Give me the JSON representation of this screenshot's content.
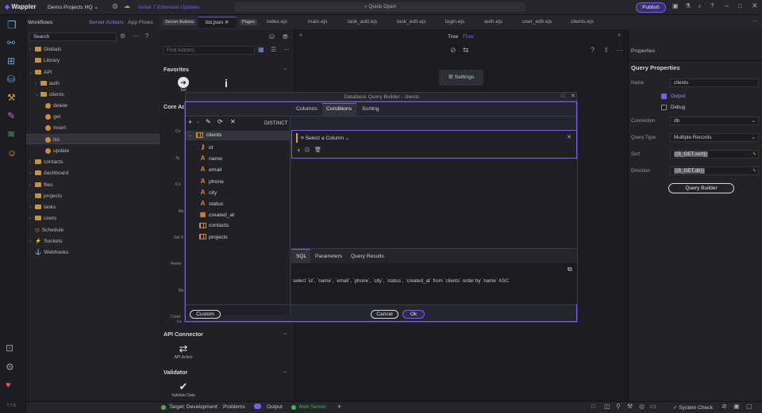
{
  "app": {
    "name": "Wappler",
    "project": "Demo Projects HQ",
    "update_notice": "Install 7 Extension Updates",
    "quick_open": "Quick Open",
    "publish": "Publish"
  },
  "workflows": {
    "title": "Workflows",
    "tab_server": "Server Actions",
    "tab_app": "App Flows",
    "search_placeholder": "Search",
    "tree": [
      {
        "label": "Globals"
      },
      {
        "label": "Library"
      },
      {
        "label": "API"
      },
      {
        "label": "auth"
      },
      {
        "label": "clients"
      },
      {
        "label": "delete"
      },
      {
        "label": "get"
      },
      {
        "label": "insert"
      },
      {
        "label": "list"
      },
      {
        "label": "update"
      },
      {
        "label": "contacts"
      },
      {
        "label": "dashboard"
      },
      {
        "label": "files"
      },
      {
        "label": "projects"
      },
      {
        "label": "tasks"
      },
      {
        "label": "users"
      },
      {
        "label": "Schedule"
      },
      {
        "label": "Sockets"
      },
      {
        "label": "Webhooks"
      }
    ]
  },
  "editor_tabs": {
    "server_actions_tag": "Server Actions",
    "pages_tag": "Pages",
    "items": [
      "list.json",
      "index.ejs",
      "main.ejs",
      "task_add.ejs",
      "task_edit.ejs",
      "login.ejs",
      "auth.ejs",
      "user_edit.ejs",
      "clients.ejs"
    ]
  },
  "components": {
    "find_placeholder": "Find Actions",
    "favorites": "Favorites",
    "core_actions": "Core Ac",
    "set_label": "Set",
    "api_connector": "API Connector",
    "api_action": "API Action",
    "validator": "Validator",
    "validate_data": "Validate Data",
    "partial_labels": [
      "Co",
      "Te",
      "Co",
      "Re",
      "Set V",
      "Remo",
      "Re",
      "Cond",
      "Lo"
    ]
  },
  "center": {
    "tree_tab": "Tree",
    "flow_tab": "Flow",
    "settings": "Settings"
  },
  "dialog": {
    "title": "Database Query Builder - clients",
    "tabs": [
      "Columns",
      "Conditions",
      "Sorting"
    ],
    "distinct": "DISTINCT",
    "table": "clients",
    "columns": [
      {
        "name": "id",
        "kind": "key"
      },
      {
        "name": "name",
        "kind": "text"
      },
      {
        "name": "email",
        "kind": "text"
      },
      {
        "name": "phone",
        "kind": "text"
      },
      {
        "name": "city",
        "kind": "text"
      },
      {
        "name": "status",
        "kind": "text"
      },
      {
        "name": "created_at",
        "kind": "date"
      },
      {
        "name": "contacts",
        "kind": "table"
      },
      {
        "name": "projects",
        "kind": "table"
      }
    ],
    "select_column": "Select a Column",
    "bottom_tabs": [
      "SQL",
      "Parameters",
      "Query Results"
    ],
    "sql": "select `id`, `name`, `email`, `phone`, `city`, `status`, `created_at` from `clients` order by `name` ASC",
    "custom": "Custom",
    "cancel": "Cancel",
    "ok": "Ok"
  },
  "properties": {
    "header": "Properties",
    "title": "Query Properties",
    "name_label": "Name",
    "name_value": "clients",
    "output_label": "Output",
    "debug_label": "Debug",
    "connection_label": "Connection",
    "connection_value": "db",
    "query_type_label": "Query Type",
    "query_type_value": "Multiple Records",
    "sort_label": "Sort",
    "sort_value": "{{$_GET.sort}}",
    "direction_label": "Direction",
    "direction_value": "{{$_GET.dir}}",
    "query_builder": "Query Builder"
  },
  "status": {
    "target": "Target: Development",
    "problems": "Problems",
    "output": "Output",
    "web_server": "Web Server",
    "system_check": "System Check",
    "version": "7.7.6"
  },
  "colors": {
    "accent": "#7a5cf5",
    "orange": "#d88a2f",
    "green": "#4caf50"
  }
}
